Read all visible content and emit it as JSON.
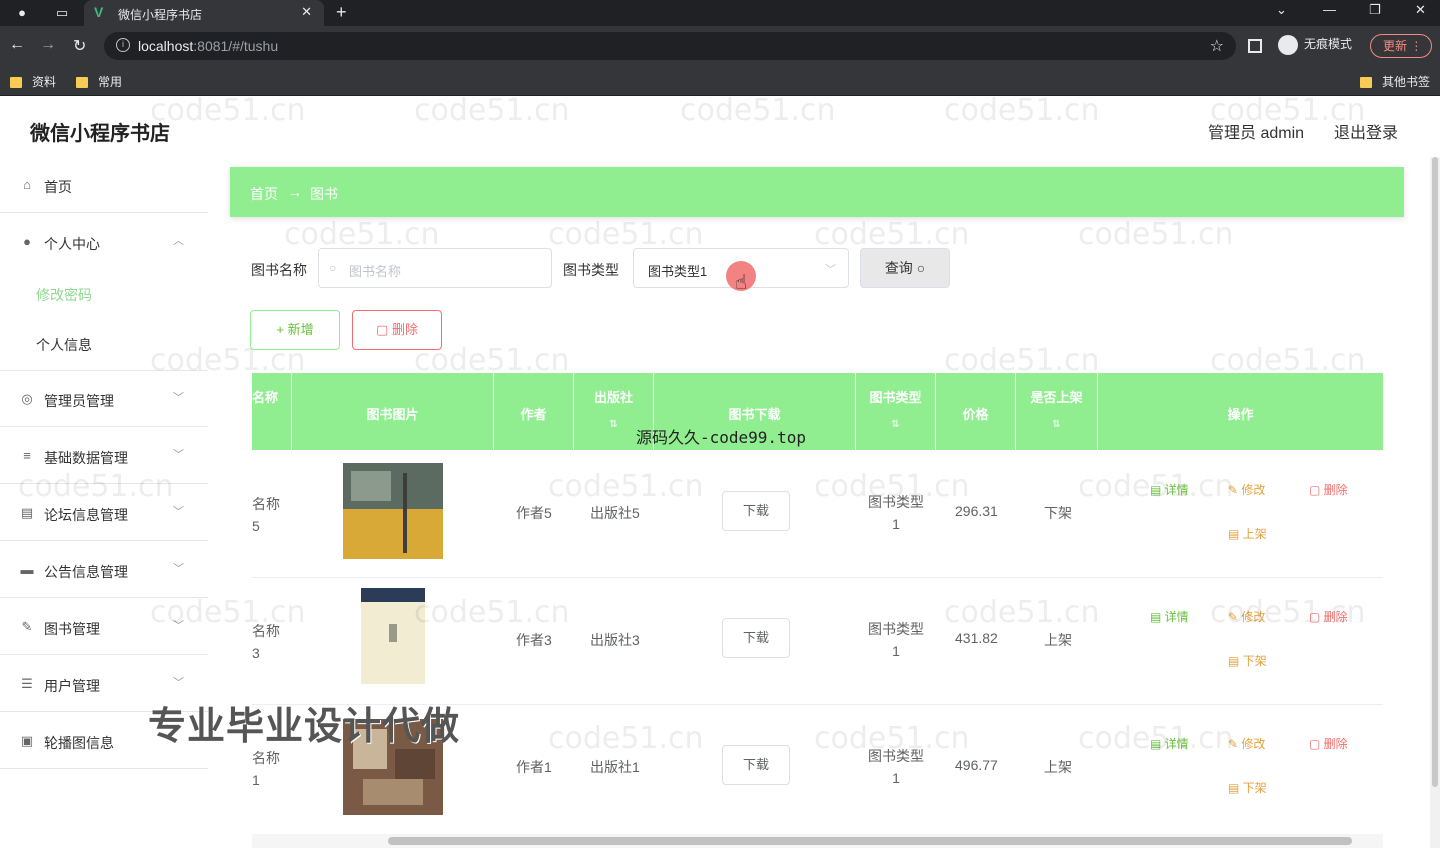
{
  "browser": {
    "tab_title": "微信小程序书店",
    "url_host": "localhost",
    "url_rest": ":8081/#/tushu",
    "incognito_label": "无痕模式",
    "update_label": "更新",
    "bookmarks": [
      "资料",
      "常用"
    ],
    "other_bookmarks": "其他书签"
  },
  "header": {
    "brand": "微信小程序书店",
    "admin": "管理员 admin",
    "logout": "退出登录"
  },
  "sidebar": {
    "items": [
      {
        "label": "首页",
        "icon": "home-icon"
      },
      {
        "label": "个人中心",
        "icon": "user-icon"
      },
      {
        "label": "管理员管理",
        "icon": "admin-icon"
      },
      {
        "label": "基础数据管理",
        "icon": "sliders-icon"
      },
      {
        "label": "论坛信息管理",
        "icon": "forum-icon"
      },
      {
        "label": "公告信息管理",
        "icon": "notice-icon"
      },
      {
        "label": "图书管理",
        "icon": "book-icon"
      },
      {
        "label": "用户管理",
        "icon": "users-icon"
      },
      {
        "label": "轮播图信息",
        "icon": "carousel-icon"
      }
    ],
    "subitems": [
      "修改密码",
      "个人信息"
    ]
  },
  "breadcrumb": {
    "home": "首页",
    "arrow": "→",
    "current": "图书"
  },
  "filters": {
    "name_label": "图书名称",
    "name_placeholder": "图书名称",
    "type_label": "图书类型",
    "type_value": "图书类型1",
    "query_label": "查询"
  },
  "actions": {
    "add": "+ 新增",
    "delete": "删除"
  },
  "table": {
    "headers": [
      "名称",
      "图书图片",
      "作者",
      "出版社",
      "图书下载",
      "图书类型",
      "价格",
      "是否上架",
      "操作"
    ],
    "rows": [
      {
        "name": "名称5",
        "author": "作者5",
        "publisher": "出版社5",
        "download": "下载",
        "type_line1": "图书类型",
        "type_line2": "1",
        "price": "296.31",
        "status": "下架",
        "detail": "详情",
        "edit": "修改",
        "remove": "删除",
        "toggle": "上架"
      },
      {
        "name": "名称3",
        "author": "作者3",
        "publisher": "出版社3",
        "download": "下载",
        "type_line1": "图书类型",
        "type_line2": "1",
        "price": "431.82",
        "status": "上架",
        "detail": "详情",
        "edit": "修改",
        "remove": "删除",
        "toggle": "下架"
      },
      {
        "name": "名称1",
        "author": "作者1",
        "publisher": "出版社1",
        "download": "下载",
        "type_line1": "图书类型",
        "type_line2": "1",
        "price": "496.77",
        "status": "上架",
        "detail": "详情",
        "edit": "修改",
        "remove": "删除",
        "toggle": "下架"
      }
    ]
  },
  "overlays": {
    "center_watermark": "源码久久-code99.top",
    "promo": "专业毕业设计代做",
    "watermark": "code51.cn"
  },
  "colors": {
    "accent": "#90ee90",
    "danger": "#f56c6c",
    "warning": "#e6a23c",
    "success": "#67c23a"
  }
}
